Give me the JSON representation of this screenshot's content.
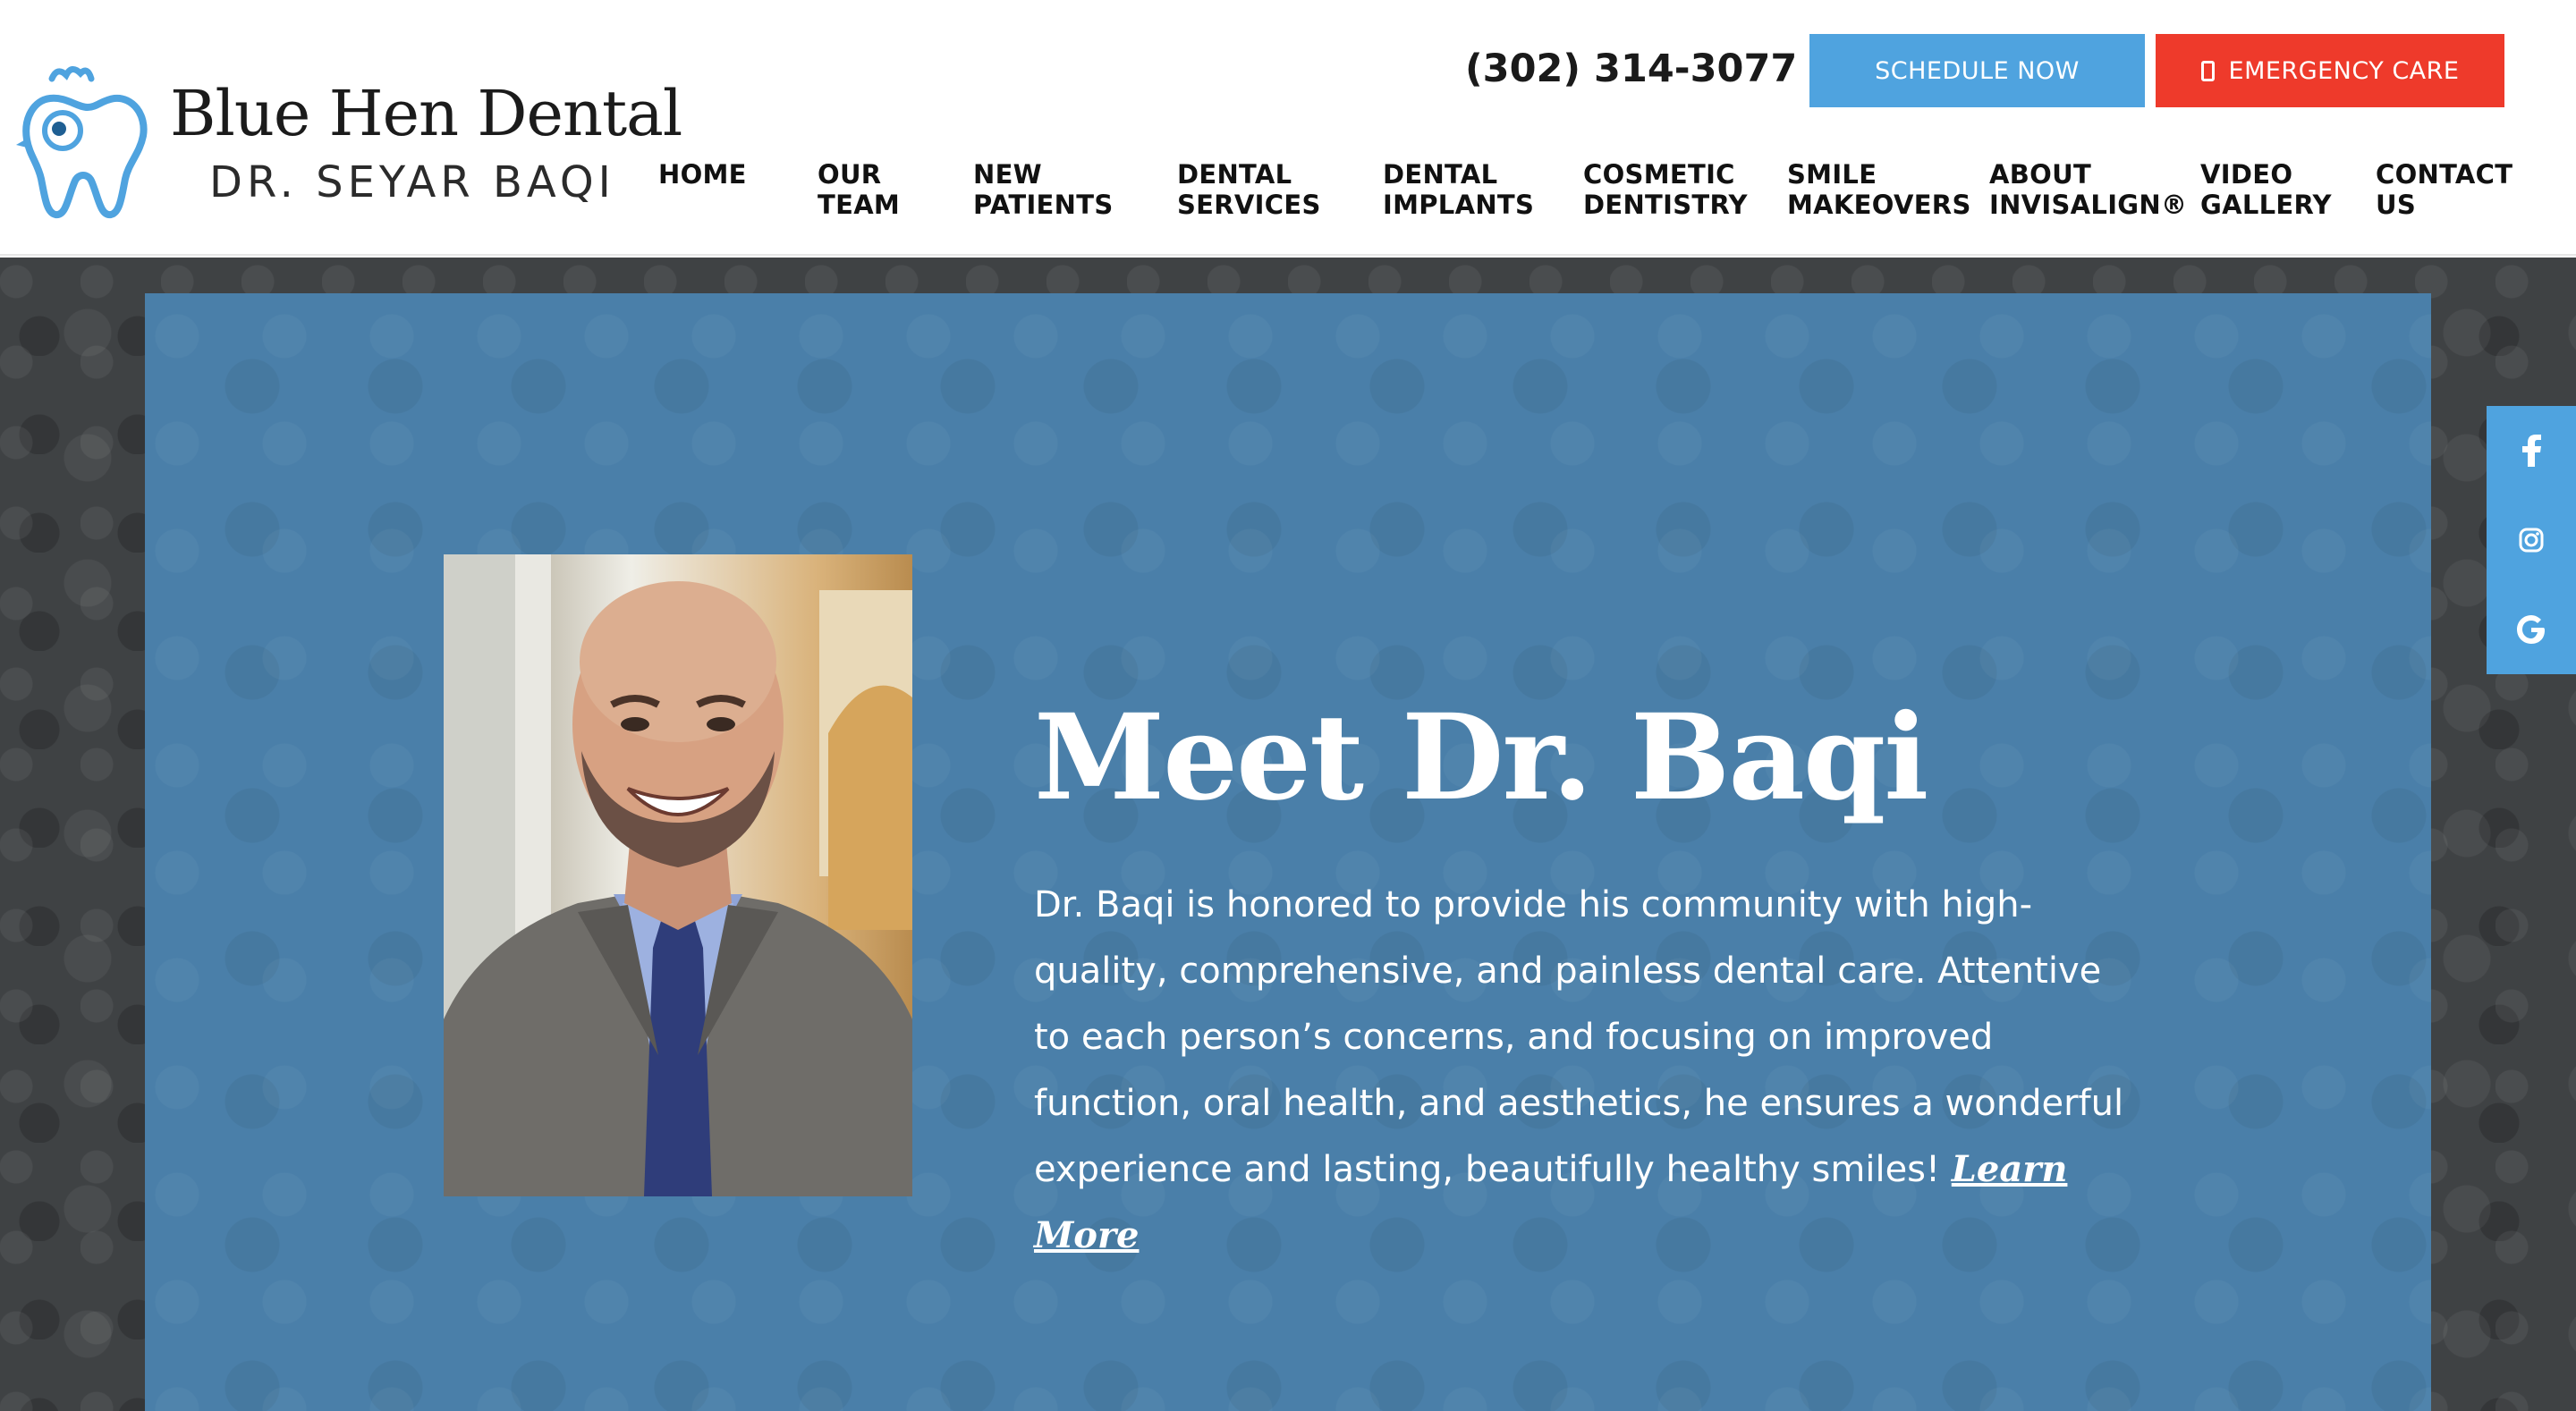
{
  "brand": {
    "title": "Blue Hen Dental",
    "subtitle": "DR. SEYAR BAQI",
    "accent": "#4fa3df",
    "emergency_color": "#ee3a2b",
    "panel_color": "#4a7fa9"
  },
  "header": {
    "phone": "(302) 314-3077",
    "schedule_label": "SCHEDULE NOW",
    "emergency_label": "EMERGENCY CARE"
  },
  "nav": [
    {
      "line1": "HOME",
      "line2": ""
    },
    {
      "line1": "OUR",
      "line2": "TEAM"
    },
    {
      "line1": "NEW",
      "line2": "PATIENTS"
    },
    {
      "line1": "DENTAL",
      "line2": "SERVICES"
    },
    {
      "line1": "DENTAL",
      "line2": "IMPLANTS"
    },
    {
      "line1": "COSMETIC",
      "line2": "DENTISTRY"
    },
    {
      "line1": "SMILE",
      "line2": "MAKEOVERS"
    },
    {
      "line1": "ABOUT",
      "line2": "INVISALIGN®"
    },
    {
      "line1": "VIDEO",
      "line2": "GALLERY"
    },
    {
      "line1": "CONTACT",
      "line2": "US"
    }
  ],
  "hero": {
    "title": "Meet Dr. Baqi",
    "body": "Dr. Baqi is honored to provide his community with high-quality, comprehensive, and painless dental care. Attentive to each person’s concerns, and focusing on improved function, oral health, and aesthetics, he ensures a wonderful experience and lasting, beautifully healthy smiles!",
    "learn_more": "Learn More"
  },
  "social": [
    {
      "icon": "facebook-icon"
    },
    {
      "icon": "instagram-icon"
    },
    {
      "icon": "google-icon"
    }
  ]
}
